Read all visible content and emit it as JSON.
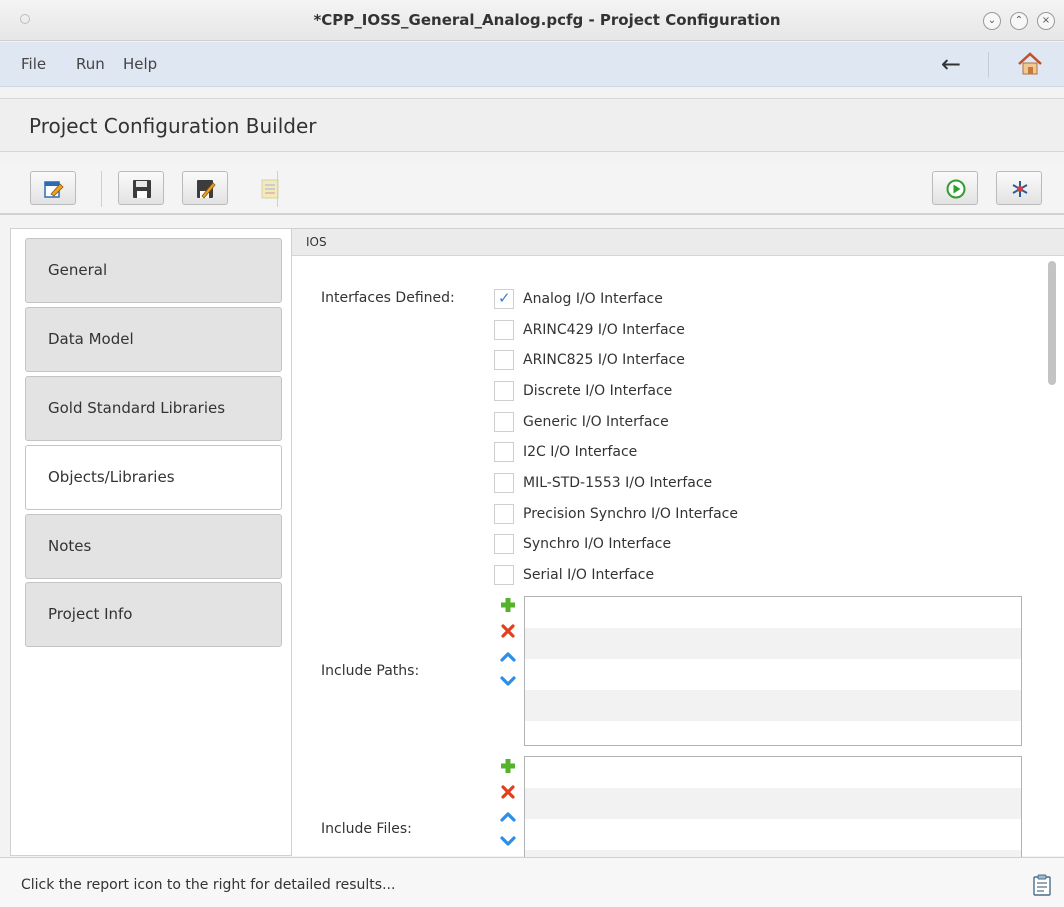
{
  "window": {
    "title": "*CPP_IOSS_General_Analog.pcfg - Project Configuration"
  },
  "menu": {
    "items": [
      "File",
      "Run",
      "Help"
    ]
  },
  "header": {
    "title": "Project Configuration Builder"
  },
  "nav": {
    "tabs": [
      {
        "label": "General"
      },
      {
        "label": "Data Model"
      },
      {
        "label": "Gold Standard Libraries"
      },
      {
        "label": "Objects/Libraries"
      },
      {
        "label": "Notes"
      },
      {
        "label": "Project Info"
      }
    ],
    "active": "Objects/Libraries"
  },
  "section": {
    "title": "IOS"
  },
  "form": {
    "interfaces_label": "Interfaces Defined:",
    "interfaces": [
      {
        "label": "Analog I/O Interface",
        "checked": true
      },
      {
        "label": "ARINC429 I/O Interface",
        "checked": false
      },
      {
        "label": "ARINC825 I/O Interface",
        "checked": false
      },
      {
        "label": "Discrete I/O Interface",
        "checked": false
      },
      {
        "label": "Generic I/O Interface",
        "checked": false
      },
      {
        "label": "I2C I/O Interface",
        "checked": false
      },
      {
        "label": "MIL-STD-1553 I/O Interface",
        "checked": false
      },
      {
        "label": "Precision Synchro I/O Interface",
        "checked": false
      },
      {
        "label": "Synchro I/O Interface",
        "checked": false
      },
      {
        "label": "Serial I/O Interface",
        "checked": false
      }
    ],
    "include_paths_label": "Include Paths:",
    "include_files_label": "Include Files:"
  },
  "status": {
    "text": "Click the report icon to the right for detailed results..."
  },
  "colors": {
    "menubar": "#dfe7f3",
    "check": "#3a7fd0",
    "add": "#55b22b",
    "remove": "#e2401c",
    "arrow": "#2c8ee6"
  }
}
